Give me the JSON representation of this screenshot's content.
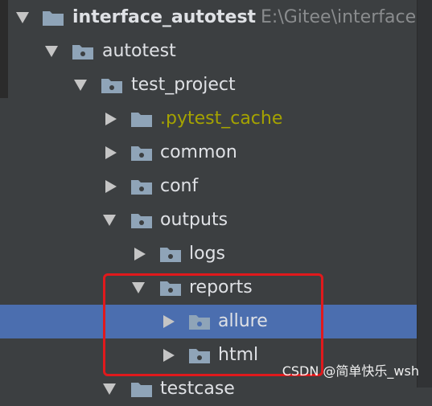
{
  "tree": {
    "root": {
      "label": "interface_autotest",
      "path": "E:\\Gitee\\interface"
    },
    "items": [
      {
        "label": "autotest"
      },
      {
        "label": "test_project"
      },
      {
        "label": ".pytest_cache"
      },
      {
        "label": "common"
      },
      {
        "label": "conf"
      },
      {
        "label": "outputs"
      },
      {
        "label": "logs"
      },
      {
        "label": "reports"
      },
      {
        "label": "allure"
      },
      {
        "label": "html"
      },
      {
        "label": "testcase"
      }
    ]
  },
  "watermark": "CSDN @简单快乐_wsh",
  "colors": {
    "background": "#3c3f41",
    "selection": "#4b6eaf",
    "folder": "#8fa4b8",
    "excluded": "#a5a300",
    "highlight_box": "#e0191c"
  },
  "icons": {
    "expanded": "triangle-down-icon",
    "collapsed": "triangle-right-icon",
    "folder": "folder-icon"
  }
}
